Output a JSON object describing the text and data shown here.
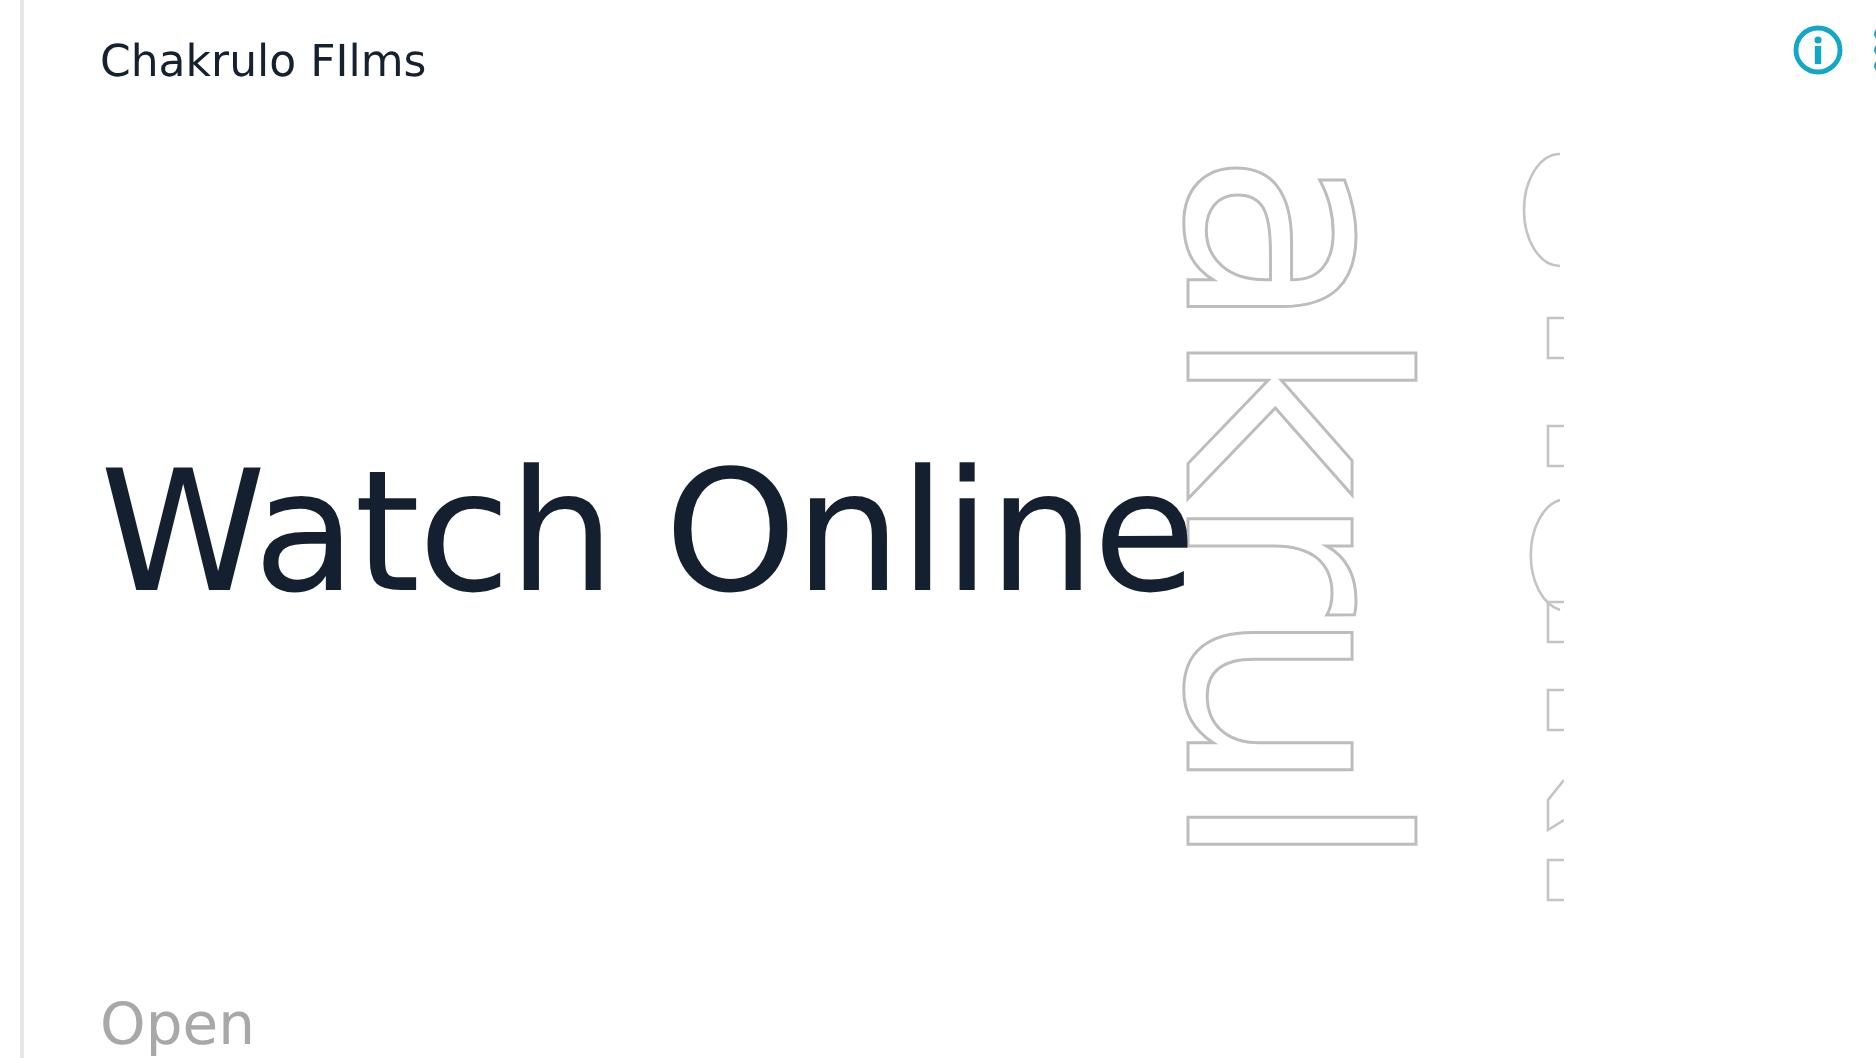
{
  "header": {
    "brand": "Chakrulo FIlms"
  },
  "hero": {
    "headline": "Watch Online",
    "outline_text": "akrul"
  },
  "action": {
    "label": "Open"
  }
}
